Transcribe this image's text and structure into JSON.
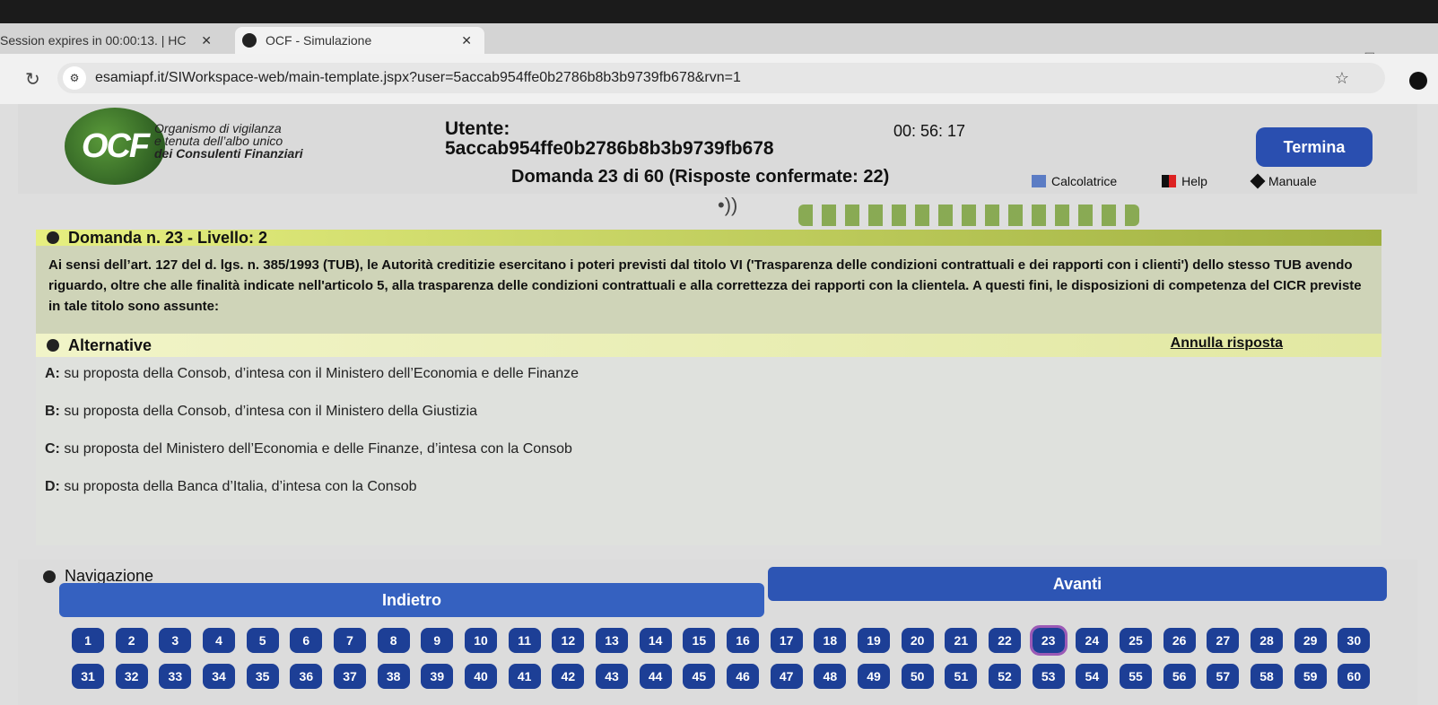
{
  "browser": {
    "tabs": [
      {
        "title": "Session expires in 00:00:13. | HC"
      },
      {
        "title": "OCF - Simulazione"
      }
    ],
    "url": "esamiapf.it/SIWorkspace-web/main-template.jspx?user=5accab954ffe0b2786b8b3b9739fb678&rvn=1"
  },
  "header": {
    "logo_text": "OCF",
    "org_line1": "Organismo di vigilanza",
    "org_line2": "e tenuta dell’albo unico",
    "org_line3": "dei Consulenti Finanziari",
    "utente_label": "Utente:",
    "utente_value": "5accab954ffe0b2786b8b3b9739fb678",
    "timer": "00: 56: 17",
    "domanda_counter": "Domanda 23 di 60 (Risposte confermate: 22)",
    "termina_label": "Termina",
    "tools": {
      "calcolatrice": "Calcolatrice",
      "help": "Help",
      "manuale": "Manuale"
    }
  },
  "question": {
    "header": "Domanda n. 23 - Livello: 2",
    "text": "Ai sensi dell’art. 127 del d. lgs. n. 385/1993 (TUB), le Autorità creditizie esercitano i poteri previsti dal titolo VI ('Trasparenza delle condizioni contrattuali e dei rapporti con i clienti') dello stesso TUB avendo riguardo, oltre che alle finalità indicate nell'articolo 5, alla trasparenza delle condizioni contrattuali e alla correttezza dei rapporti con la clientela. A questi fini, le disposizioni di competenza del CICR previste in tale titolo sono assunte:"
  },
  "alternatives": {
    "header": "Alternative",
    "annulla": "Annulla risposta",
    "items": [
      {
        "key": "A:",
        "text": "su proposta della Consob, d’intesa con il Ministero dell’Economia e delle Finanze"
      },
      {
        "key": "B:",
        "text": "su proposta della Consob, d’intesa con il Ministero della Giustizia"
      },
      {
        "key": "C:",
        "text": "su proposta del Ministero dell’Economia e delle Finanze, d’intesa con la Consob"
      },
      {
        "key": "D:",
        "text": "su proposta della Banca d’Italia, d’intesa con la Consob"
      }
    ]
  },
  "navigation": {
    "title": "Navigazione",
    "indietro": "Indietro",
    "avanti": "Avanti",
    "current": 23,
    "row1": [
      "1",
      "2",
      "3",
      "4",
      "5",
      "6",
      "7",
      "8",
      "9",
      "10",
      "11",
      "12",
      "13",
      "14",
      "15",
      "16",
      "17",
      "18",
      "19",
      "20",
      "21",
      "22",
      "23",
      "24",
      "25",
      "26",
      "27",
      "28",
      "29",
      "30"
    ],
    "row2": [
      "31",
      "32",
      "33",
      "34",
      "35",
      "36",
      "37",
      "38",
      "39",
      "40",
      "41",
      "42",
      "43",
      "44",
      "45",
      "46",
      "47",
      "48",
      "49",
      "50",
      "51",
      "52",
      "53",
      "54",
      "55",
      "56",
      "57",
      "58",
      "59",
      "60"
    ]
  }
}
